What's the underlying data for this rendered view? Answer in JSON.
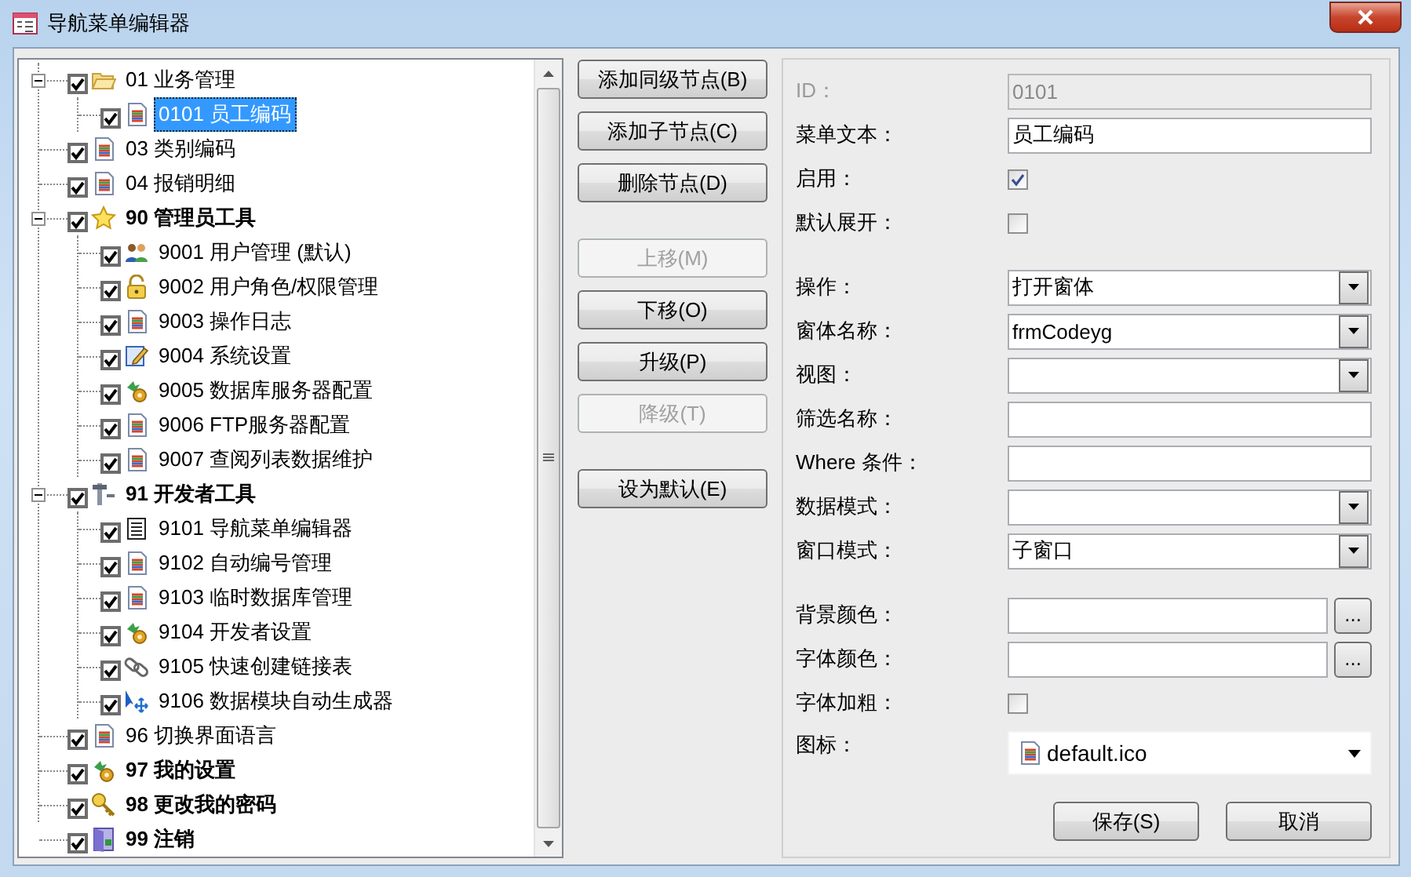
{
  "window": {
    "title": "导航菜单编辑器"
  },
  "tree": [
    {
      "label": "01 业务管理",
      "kind": "folder",
      "bold": false,
      "checked": true,
      "expanded": true,
      "selected": false,
      "children": [
        {
          "label": "0101 员工编码",
          "kind": "doc",
          "bold": false,
          "checked": true,
          "selected": true
        }
      ]
    },
    {
      "label": "03 类别编码",
      "kind": "doc",
      "bold": false,
      "checked": true,
      "selected": false
    },
    {
      "label": "04 报销明细",
      "kind": "doc",
      "bold": false,
      "checked": true,
      "selected": false
    },
    {
      "label": "90 管理员工具",
      "kind": "star",
      "bold": true,
      "checked": true,
      "expanded": true,
      "selected": false,
      "children": [
        {
          "label": "9001 用户管理 (默认)",
          "kind": "users",
          "bold": false,
          "checked": true,
          "selected": false
        },
        {
          "label": "9002 用户角色/权限管理",
          "kind": "lock",
          "bold": false,
          "checked": true,
          "selected": false
        },
        {
          "label": "9003 操作日志",
          "kind": "doc",
          "bold": false,
          "checked": true,
          "selected": false
        },
        {
          "label": "9004 系统设置",
          "kind": "form",
          "bold": false,
          "checked": true,
          "selected": false
        },
        {
          "label": "9005 数据库服务器配置",
          "kind": "gears",
          "bold": false,
          "checked": true,
          "selected": false
        },
        {
          "label": "9006 FTP服务器配置",
          "kind": "doc",
          "bold": false,
          "checked": true,
          "selected": false
        },
        {
          "label": "9007 查阅列表数据维护",
          "kind": "doc",
          "bold": false,
          "checked": true,
          "selected": false
        }
      ]
    },
    {
      "label": "91 开发者工具",
      "kind": "tools",
      "bold": true,
      "checked": true,
      "expanded": true,
      "selected": false,
      "children": [
        {
          "label": "9101 导航菜单编辑器",
          "kind": "list",
          "bold": false,
          "checked": true,
          "selected": false
        },
        {
          "label": "9102 自动编号管理",
          "kind": "doc",
          "bold": false,
          "checked": true,
          "selected": false
        },
        {
          "label": "9103 临时数据库管理",
          "kind": "doc",
          "bold": false,
          "checked": true,
          "selected": false
        },
        {
          "label": "9104 开发者设置",
          "kind": "gears",
          "bold": false,
          "checked": true,
          "selected": false
        },
        {
          "label": "9105 快速创建链接表",
          "kind": "link",
          "bold": false,
          "checked": true,
          "selected": false
        },
        {
          "label": "9106 数据模块自动生成器",
          "kind": "move",
          "bold": false,
          "checked": true,
          "selected": false
        }
      ]
    },
    {
      "label": "96 切换界面语言",
      "kind": "doc",
      "bold": false,
      "checked": true,
      "selected": false
    },
    {
      "label": "97 我的设置",
      "kind": "gears",
      "bold": true,
      "checked": true,
      "selected": false
    },
    {
      "label": "98 更改我的密码",
      "kind": "key",
      "bold": true,
      "checked": true,
      "selected": false
    },
    {
      "label": "99 注销",
      "kind": "door",
      "bold": true,
      "checked": true,
      "selected": false
    }
  ],
  "action_buttons": [
    [
      {
        "label": "添加同级节点(B)",
        "disabled": false
      },
      {
        "label": "添加子节点(C)",
        "disabled": false
      },
      {
        "label": "删除节点(D)",
        "disabled": false
      }
    ],
    [
      {
        "label": "上移(M)",
        "disabled": true
      },
      {
        "label": "下移(O)",
        "disabled": false
      },
      {
        "label": "升级(P)",
        "disabled": false
      },
      {
        "label": "降级(T)",
        "disabled": true
      }
    ],
    [
      {
        "label": "设为默认(E)",
        "disabled": false
      }
    ]
  ],
  "form": {
    "groups": [
      [
        {
          "kind": "text",
          "label": "ID：",
          "value": "0101",
          "disabled": true
        },
        {
          "kind": "text",
          "label": "菜单文本：",
          "value": "员工编码",
          "disabled": false
        },
        {
          "kind": "checkbox",
          "label": "启用：",
          "checked": true
        },
        {
          "kind": "checkbox",
          "label": "默认展开：",
          "checked": false
        }
      ],
      [
        {
          "kind": "combo",
          "label": "操作：",
          "value": "打开窗体"
        },
        {
          "kind": "combo",
          "label": "窗体名称：",
          "value": "frmCodeyg"
        },
        {
          "kind": "combo",
          "label": "视图："
        },
        {
          "kind": "text",
          "label": "筛选名称：",
          "disabled": false
        },
        {
          "kind": "text",
          "label": "Where 条件：",
          "disabled": false
        },
        {
          "kind": "combo",
          "label": "数据模式："
        },
        {
          "kind": "combo",
          "label": "窗口模式：",
          "value": "子窗口"
        }
      ],
      [
        {
          "kind": "color",
          "label": "背景颜色：",
          "button": "..."
        },
        {
          "kind": "color",
          "label": "字体颜色：",
          "button": "..."
        },
        {
          "kind": "checkbox",
          "label": "字体加粗：",
          "checked": false
        },
        {
          "kind": "icon_combo",
          "label": "图标：",
          "value": "default.ico"
        }
      ]
    ],
    "buttons": [
      "保存(S)",
      "取消"
    ]
  }
}
